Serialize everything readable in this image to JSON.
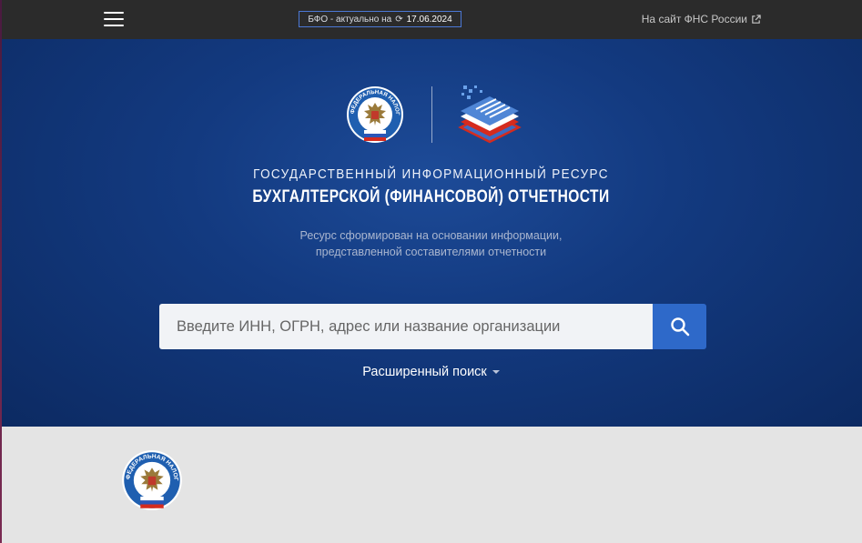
{
  "header": {
    "menu_icon": "hamburger-menu-icon",
    "badge": {
      "prefix": "БФО - актуально на",
      "sync_icon": "refresh-icon",
      "date": "17.06.2024"
    },
    "external_link": {
      "label": "На сайт ФНС России",
      "icon": "external-link-icon"
    }
  },
  "hero": {
    "title_line1": "Государственный информационный ресурс",
    "title_line2": "бухгалтерской (финансовой) отчетности",
    "subtitle_line1": "Ресурс сформирован на основании информации,",
    "subtitle_line2": "представленной составителями отчетности",
    "emblem_text": "ФЕДЕРАЛЬНАЯ НАЛОГОВАЯ СЛУЖБА",
    "search": {
      "placeholder": "Введите ИНН, ОГРН, адрес или название организации",
      "value": "",
      "button_icon": "search-icon"
    },
    "advanced_search": "Расширенный поиск"
  },
  "footer": {
    "emblem_text": "ФЕДЕРАЛЬНАЯ НАЛОГОВАЯ СЛУЖБА"
  },
  "colors": {
    "topbar": "#2b2b2b",
    "hero_dark": "#0c2a62",
    "hero_light": "#1d4b98",
    "accent": "#2e69c9",
    "footer": "#e4e4e4"
  }
}
